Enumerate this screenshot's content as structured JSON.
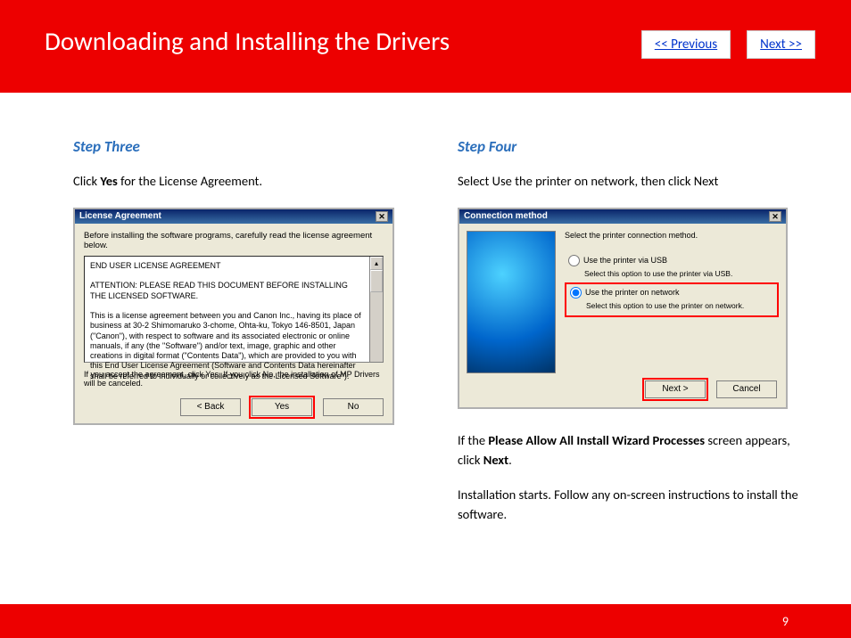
{
  "header": {
    "title": "Downloading and Installing  the Drivers",
    "prev": "<< Previous",
    "next": "Next >>"
  },
  "step3": {
    "title": "Step Three",
    "text_prefix": "Click ",
    "text_bold": "Yes",
    "text_suffix": " for the License Agreement.",
    "win_title": "License Agreement",
    "intro": "Before installing the software programs, carefully read the license agreement below.",
    "eula_heading": "END USER LICENSE AGREEMENT",
    "eula_attention": "ATTENTION: PLEASE READ THIS DOCUMENT BEFORE INSTALLING THE LICENSED SOFTWARE.",
    "eula_body": "This is a license agreement between you and Canon Inc., having its place of business at 30-2 Shimomaruko 3-chome, Ohta-ku, Tokyo 146-8501, Japan (\"Canon\"), with respect to software and its associated electronic or online manuals, if any (the \"Software\") and/or text, image, graphic and other creations in digital format (\"Contents Data\"), which are provided to you with this End User License Agreement (Software and Contents Data hereinafter shall be referred to individually or collectively as the Licensed Software\").",
    "accept_text": "If you accept the agreement, click Yes. If you click No, the installation of MP Drivers will be canceled.",
    "btn_back": "< Back",
    "btn_yes": "Yes",
    "btn_no": "No"
  },
  "step4": {
    "title": "Step Four",
    "text": "Select  Use the printer on network, then click Next",
    "win_title": "Connection method",
    "select_text": "Select the printer connection method.",
    "opt_usb_label": "Use the printer via USB",
    "opt_usb_desc": "Select this option to use the printer via USB.",
    "opt_net_label": "Use the printer on network",
    "opt_net_desc": "Select this option to use the printer on network.",
    "btn_next": "Next >",
    "btn_cancel": "Cancel",
    "after1_prefix": " If the ",
    "after1_bold1": "Please Allow All Install Wizard Processes",
    "after1_mid": " screen appears, click ",
    "after1_bold2": "Next",
    "after1_suffix": ".",
    "after2": "Installation starts. Follow any on-screen instructions to install the software."
  },
  "footer": {
    "page": "9"
  }
}
